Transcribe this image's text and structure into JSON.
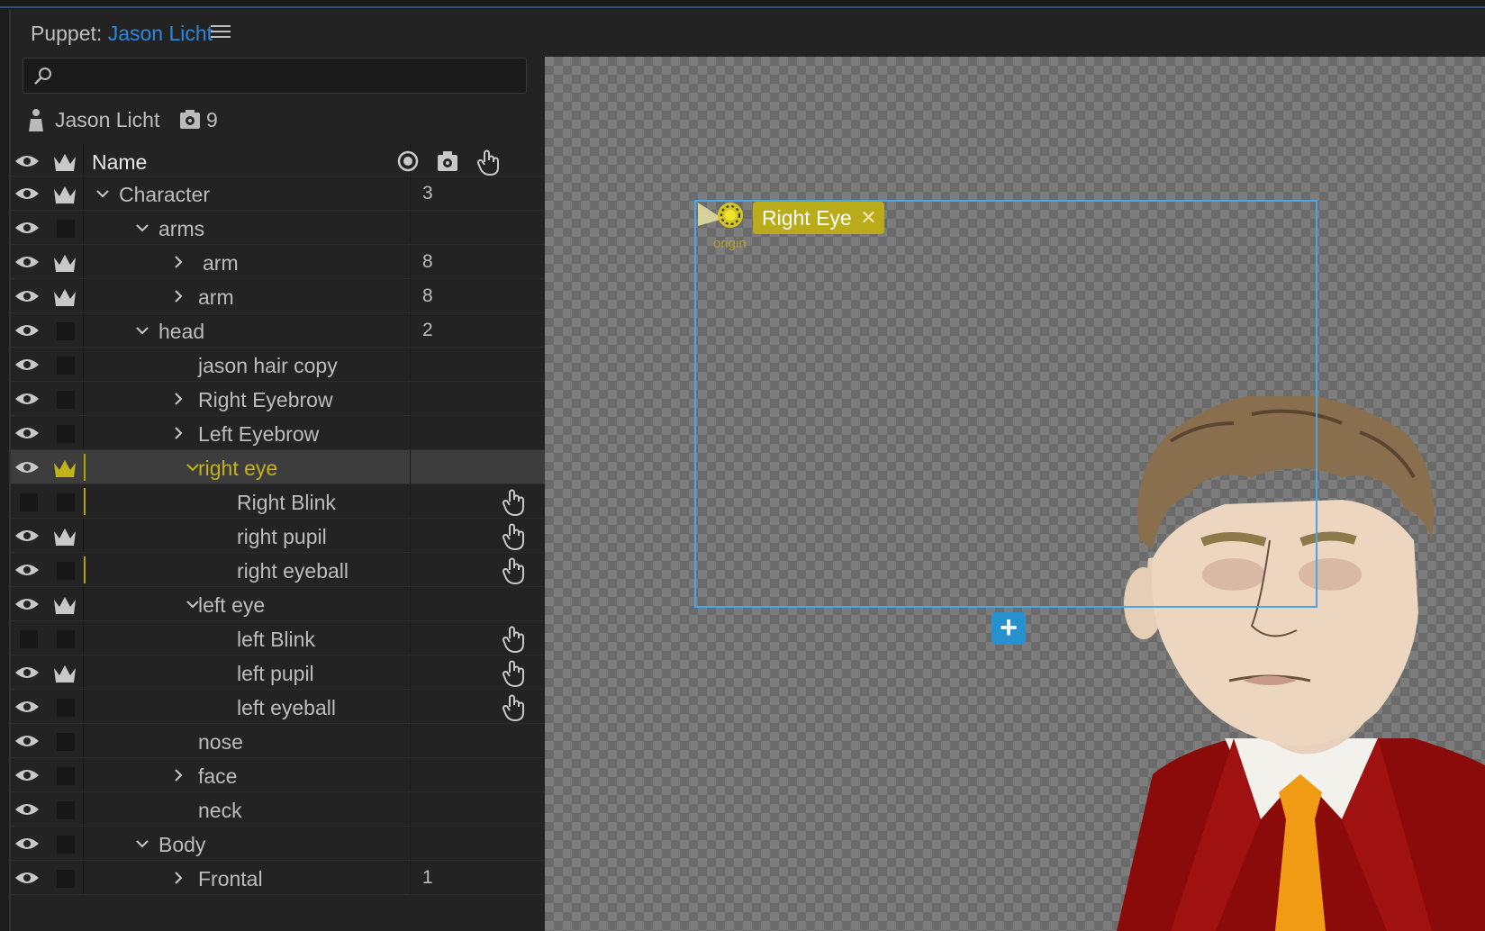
{
  "header": {
    "prefix": "Puppet:",
    "puppet_name": "Jason Licht"
  },
  "search": {
    "placeholder": "",
    "value": ""
  },
  "puppet": {
    "name": "Jason Licht",
    "count": "9"
  },
  "columns": {
    "name": "Name"
  },
  "rows": [
    {
      "label": "Character",
      "count": "3",
      "expanded": true
    },
    {
      "label": "arms",
      "count": "",
      "expanded": true
    },
    {
      "label": "arm",
      "count": "8",
      "expanded": false
    },
    {
      "label": "arm",
      "count": "8",
      "expanded": false
    },
    {
      "label": "head",
      "count": "2",
      "expanded": true
    },
    {
      "label": "jason hair copy",
      "count": ""
    },
    {
      "label": "Right Eyebrow",
      "count": "",
      "expanded": false
    },
    {
      "label": "Left Eyebrow",
      "count": "",
      "expanded": false
    },
    {
      "label": "right eye",
      "count": "",
      "expanded": true,
      "selected": true
    },
    {
      "label": "Right Blink",
      "count": ""
    },
    {
      "label": "right pupil",
      "count": ""
    },
    {
      "label": "right eyeball",
      "count": ""
    },
    {
      "label": "left eye",
      "count": "",
      "expanded": true
    },
    {
      "label": "left Blink",
      "count": ""
    },
    {
      "label": "left pupil",
      "count": ""
    },
    {
      "label": "left eyeball",
      "count": ""
    },
    {
      "label": "nose",
      "count": ""
    },
    {
      "label": "face",
      "count": "",
      "expanded": false
    },
    {
      "label": "neck",
      "count": ""
    },
    {
      "label": "Body",
      "count": "",
      "expanded": true
    },
    {
      "label": "Frontal",
      "count": "1",
      "expanded": false
    }
  ],
  "canvas": {
    "handle_tag": "Right Eye",
    "close_glyph": "✕",
    "origin_label": "origin",
    "add_glyph": "+"
  },
  "colors": {
    "accent_blue": "#2b88e0",
    "selection_yellow": "#c3b31a",
    "tag_bg": "#b9ab1a",
    "bbox_blue": "#4aa5e6"
  }
}
